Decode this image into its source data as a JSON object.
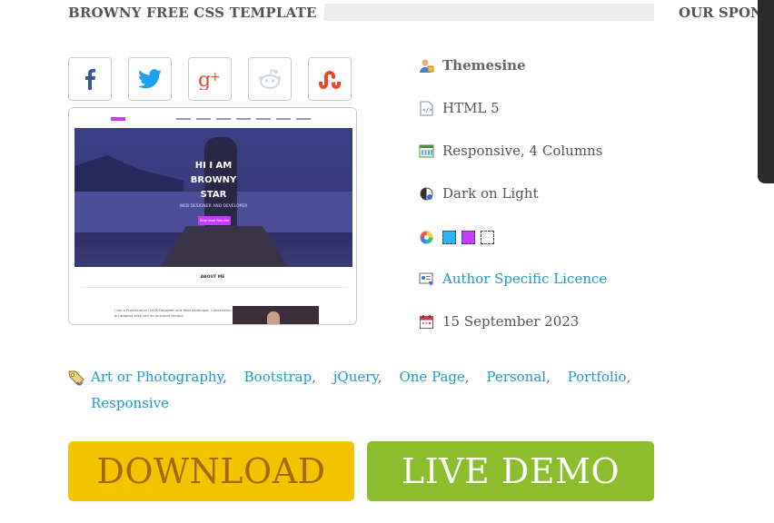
{
  "header": {
    "title": "BROWNY FREE CSS TEMPLATE",
    "sponsor_title": "OUR SPON"
  },
  "social_buttons": [
    {
      "icon": "facebook-icon",
      "color": "#3b5998"
    },
    {
      "icon": "twitter-icon",
      "color": "#1da1f2"
    },
    {
      "icon": "google-plus-icon",
      "color": "#dd4b39"
    },
    {
      "icon": "reddit-icon",
      "color": "#cfd7e0"
    },
    {
      "icon": "stumbleupon-icon",
      "color": "#eb4924"
    }
  ],
  "preview": {
    "hero_line1": "HI I AM",
    "hero_line2": "BROWNY",
    "hero_line3": "STAR",
    "hero_sub": "WEB DESIGNER AND DEVELOPER",
    "hero_button": "Download Resume",
    "about_heading": "ABOUT ME",
    "about_text": "I am a Professional UI/UX Designer and Web developer. Consectetur an adipisci elite sed do eiusmod tempor"
  },
  "meta": {
    "author": "Themesine",
    "technology": "HTML 5",
    "layout": "Responsive, 4 Columns",
    "theme": "Dark on Light",
    "colors": [
      "#29b6f6",
      "#c53cff",
      "#ffffff"
    ],
    "licence": "Author Specific Licence",
    "date": "15 September 2023"
  },
  "tags": {
    "row1": [
      "Art or Photography",
      "Bootstrap",
      "jQuery",
      "One Page",
      "Personal",
      "Portfolio"
    ],
    "row2": [
      "Responsive"
    ],
    "separator": ","
  },
  "buttons": {
    "download": "DOWNLOAD",
    "live_demo": "LIVE DEMO"
  }
}
